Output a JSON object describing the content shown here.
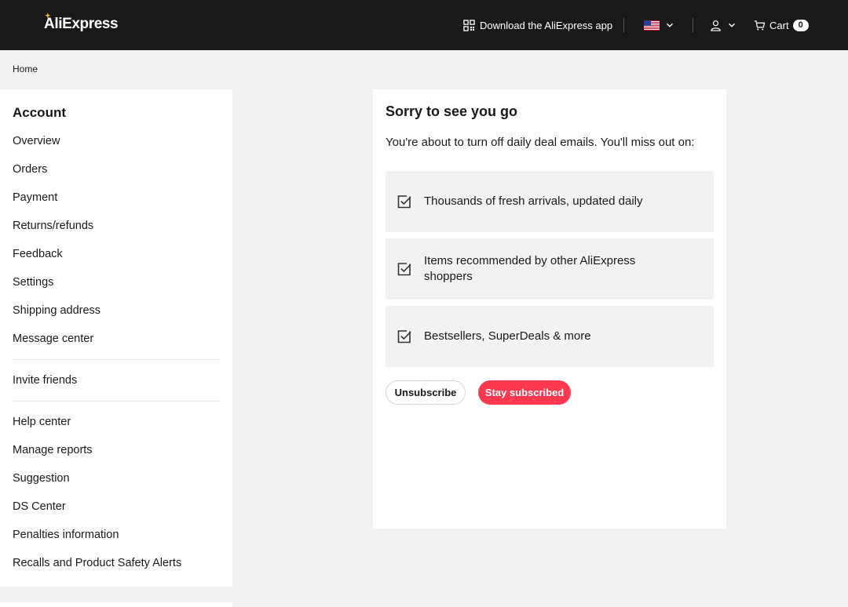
{
  "header": {
    "logo": "AliExpress",
    "download_app": "Download the AliExpress app",
    "cart_label": "Cart",
    "cart_count": "0",
    "icons": [
      "qr-code-icon",
      "us-flag-icon",
      "chevron-down-icon",
      "user-icon",
      "cart-icon"
    ]
  },
  "breadcrumb": "Home",
  "sidebar": {
    "title": "Account",
    "group1": [
      "Overview",
      "Orders",
      "Payment",
      "Returns/refunds",
      "Feedback",
      "Settings",
      "Shipping address",
      "Message center"
    ],
    "group2": [
      "Invite friends"
    ],
    "group3": [
      "Help center",
      "Manage reports",
      "Suggestion",
      "DS Center",
      "Penalties information",
      "Recalls and Product Safety Alerts"
    ]
  },
  "card": {
    "title": "Sorry to see you go",
    "description": "You're about to turn off daily deal emails. You'll miss out on:",
    "benefits": [
      "Thousands of fresh arrivals, updated daily",
      "Items recommended by other AliExpress shoppers",
      "Bestsellers, SuperDeals & more"
    ],
    "unsubscribe_label": "Unsubscribe",
    "stay_label": "Stay subscribed"
  },
  "colors": {
    "topbar": "#191919",
    "accent": "#fd384f",
    "background": "#f2f2f2"
  }
}
